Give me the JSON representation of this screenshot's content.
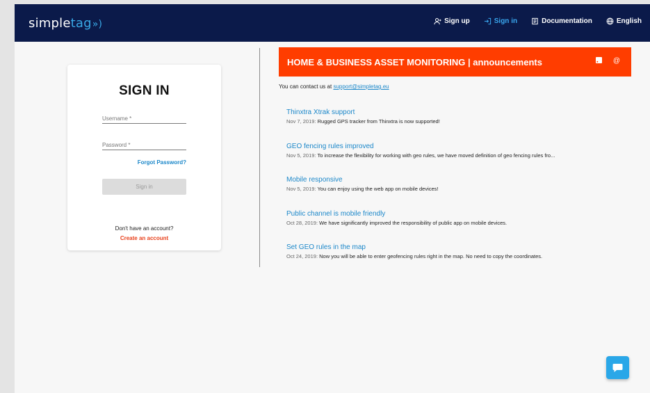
{
  "app": {
    "logo_simple": "simple",
    "logo_tag": "tag",
    "logo_waves": "»)"
  },
  "nav": {
    "signup": "Sign up",
    "signin": "Sign in",
    "documentation": "Documentation",
    "language": "English"
  },
  "signin": {
    "title": "SIGN IN",
    "username_placeholder": "Username *",
    "password_placeholder": "Password *",
    "forgot": "Forgot Password?",
    "button": "Sign in",
    "no_account": "Don't have an account?",
    "create": "Create an account"
  },
  "announcements": {
    "title": "HOME & BUSINESS ASSET MONITORING | announcements",
    "contact_prefix": "You can contact us at ",
    "contact_email": "support@simpletag.eu",
    "items": [
      {
        "title": "Thinxtra Xtrak support",
        "date": "Nov 7, 2019:",
        "text": " Rugged GPS tracker from Thinxtra is now supported!"
      },
      {
        "title": "GEO fencing rules improved",
        "date": "Nov 5, 2019:",
        "text": " To increase the flexibility for working with geo rules, we have moved definition of geo fencing rules fro..."
      },
      {
        "title": "Mobile responsive",
        "date": "Nov 5, 2019:",
        "text": " You can enjoy using the web app on mobile devices!"
      },
      {
        "title": "Public channel is mobile friendly",
        "date": "Oct 28, 2019:",
        "text": " We have significantly improved the responsibility of public app on mobile devices."
      },
      {
        "title": "Set GEO rules in the map",
        "date": "Oct 24, 2019:",
        "text": " Now you will be able to enter geofencing rules right in the map. No need to copy the coordinates."
      }
    ]
  },
  "icons": {
    "signup": "user-plus-icon",
    "signin": "sign-in-icon",
    "documentation": "book-icon",
    "language": "globe-icon",
    "rss": "rss-icon",
    "email": "at-icon",
    "chat": "chat-icon"
  },
  "colors": {
    "topbar": "#0b1a4a",
    "accent": "#ff3d00",
    "link": "#1b87c9",
    "chat": "#2aa7e8"
  }
}
